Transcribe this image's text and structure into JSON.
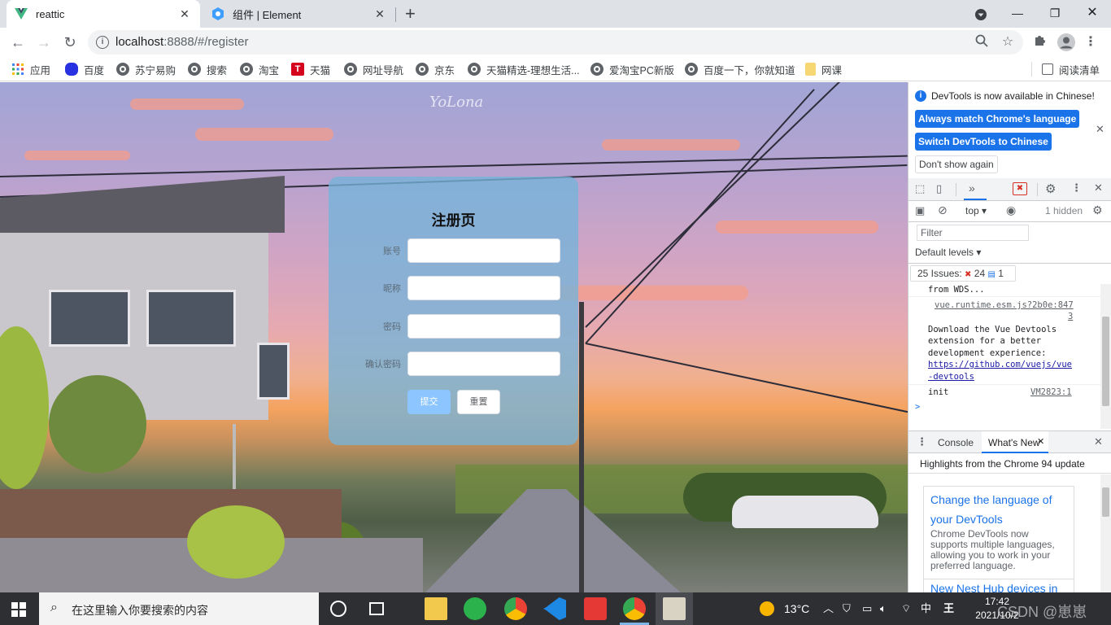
{
  "browser": {
    "tabs": [
      {
        "title": "reattic",
        "active": true
      },
      {
        "title": "组件 | Element",
        "active": false
      }
    ],
    "new_tab_icon": "plus-icon",
    "window_controls": [
      "minimize-icon",
      "restore-icon",
      "close-icon"
    ],
    "url_host": "localhost",
    "url_rest": ":8888/#/register",
    "bookmarks": [
      {
        "label": "应用",
        "icon": "apps-grid-icon"
      },
      {
        "label": "百度",
        "icon": "baidu-paw-icon"
      },
      {
        "label": "苏宁易购",
        "icon": "globe-icon"
      },
      {
        "label": "搜索",
        "icon": "globe-icon"
      },
      {
        "label": "淘宝",
        "icon": "globe-icon"
      },
      {
        "label": "天猫",
        "icon": "tmall-icon"
      },
      {
        "label": "网址导航",
        "icon": "globe-icon"
      },
      {
        "label": "京东",
        "icon": "globe-icon"
      },
      {
        "label": "天猫精选-理想生活...",
        "icon": "globe-icon"
      },
      {
        "label": "爱淘宝PC新版",
        "icon": "globe-icon"
      },
      {
        "label": "百度一下，你就知道",
        "icon": "globe-icon"
      },
      {
        "label": "网课",
        "icon": "folder-icon"
      }
    ],
    "reading_list": "阅读清单"
  },
  "page": {
    "watermark": "YoLona",
    "form": {
      "title": "注册页",
      "fields": [
        {
          "label": "账号",
          "value": ""
        },
        {
          "label": "昵称",
          "value": ""
        },
        {
          "label": "密码",
          "value": ""
        },
        {
          "label": "确认密码",
          "value": ""
        }
      ],
      "submit_label": "提交",
      "reset_label": "重置"
    }
  },
  "devtools": {
    "info_message": "DevTools is now available in Chinese!",
    "btn_match": "Always match Chrome's language",
    "btn_switch": "Switch DevTools to Chinese",
    "btn_dont_show": "Don't show again",
    "context": "top",
    "hidden_count": "1 hidden",
    "filter_placeholder": "Filter",
    "levels": "Default levels",
    "issues_label": "25 Issues:",
    "issues_errors": "24",
    "issues_info": "1",
    "console_lines": [
      {
        "text": "from WDS...",
        "kind": "text"
      },
      {
        "text": "vue.runtime.esm.js?2b0e:847",
        "kind": "link"
      },
      {
        "text": "3",
        "kind": "link"
      },
      {
        "text": "Download the Vue Devtools",
        "kind": "text"
      },
      {
        "text": "extension for a better",
        "kind": "text"
      },
      {
        "text": "development experience:",
        "kind": "text"
      },
      {
        "text": "https://github.com/vuejs/vue",
        "kind": "link"
      },
      {
        "text": "-devtools",
        "kind": "link"
      },
      {
        "text": "init",
        "kind": "text"
      },
      {
        "text": "VM2823:1",
        "kind": "link"
      }
    ],
    "prompt": ">",
    "drawer_tabs": [
      "Console",
      "What's New"
    ],
    "whats_new_header": "Highlights from the Chrome 94 update",
    "whats_new_cards": [
      {
        "title_line1": "Change the language of",
        "title_line2": "your DevTools",
        "body": [
          "Chrome DevTools now",
          "supports multiple languages,",
          "allowing you to work in your",
          "preferred language."
        ]
      },
      {
        "title_line1": "New Nest Hub devices in"
      }
    ]
  },
  "taskbar": {
    "search_placeholder": "在这里输入你要搜索的内容",
    "weather": "13°C",
    "ime": "中",
    "time": "17:42",
    "date": "2021/10/2",
    "watermark": "CSDN @崽崽"
  },
  "colors": {
    "accent": "#1a73e8",
    "card": "#74b4da",
    "primary_button": "#8cc5ff"
  }
}
